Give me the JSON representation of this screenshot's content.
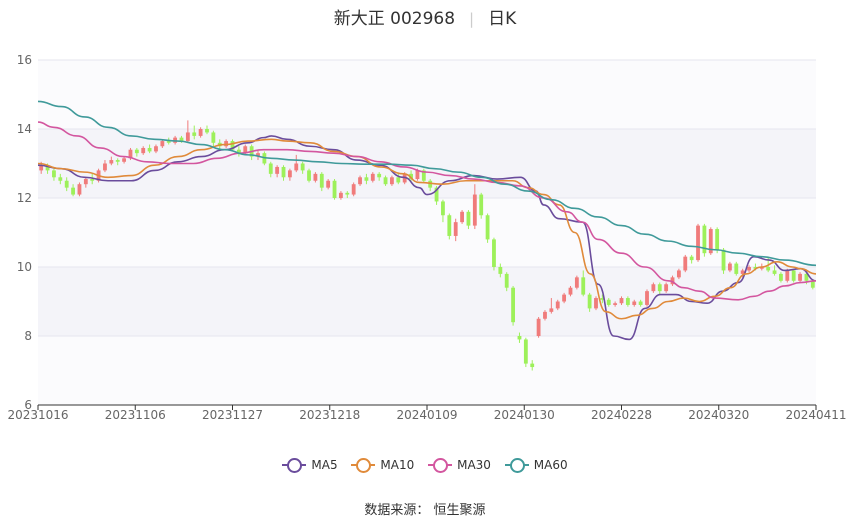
{
  "title": {
    "stock": "新大正 002968",
    "period": "日K"
  },
  "source": "数据来源：  恒生聚源",
  "legend": [
    {
      "label": "MA5",
      "color": "#6a4c9c"
    },
    {
      "label": "MA10",
      "color": "#e08a3a"
    },
    {
      "label": "MA30",
      "color": "#d3569f"
    },
    {
      "label": "MA60",
      "color": "#3f9a9a"
    }
  ],
  "colors": {
    "up": "#f07b7b",
    "down": "#9df05a",
    "band": "#f4f4f9"
  },
  "chart_data": {
    "type": "candlestick",
    "ylim": [
      6,
      16
    ],
    "y_ticks": [
      "6",
      "8",
      "10",
      "12",
      "14",
      "16"
    ],
    "x_tick_labels": [
      "20231016",
      "20231106",
      "20231127",
      "20231218",
      "20240109",
      "20240130",
      "20240228",
      "20240320",
      "20240411"
    ],
    "candles": [
      [
        12.8,
        12.95,
        12.7,
        13.05
      ],
      [
        12.95,
        12.8,
        12.7,
        13.0
      ],
      [
        12.8,
        12.6,
        12.5,
        12.85
      ],
      [
        12.6,
        12.5,
        12.4,
        12.7
      ],
      [
        12.5,
        12.3,
        12.2,
        12.6
      ],
      [
        12.3,
        12.1,
        12.05,
        12.4
      ],
      [
        12.1,
        12.4,
        12.05,
        12.45
      ],
      [
        12.4,
        12.55,
        12.3,
        12.6
      ],
      [
        12.55,
        12.5,
        12.4,
        12.7
      ],
      [
        12.5,
        12.8,
        12.45,
        12.85
      ],
      [
        12.8,
        13.0,
        12.75,
        13.1
      ],
      [
        13.0,
        13.1,
        12.95,
        13.2
      ],
      [
        13.1,
        13.05,
        12.95,
        13.15
      ],
      [
        13.05,
        13.15,
        13.0,
        13.2
      ],
      [
        13.15,
        13.4,
        13.1,
        13.45
      ],
      [
        13.4,
        13.3,
        13.2,
        13.45
      ],
      [
        13.3,
        13.45,
        13.25,
        13.5
      ],
      [
        13.45,
        13.35,
        13.3,
        13.55
      ],
      [
        13.35,
        13.5,
        13.3,
        13.55
      ],
      [
        13.5,
        13.65,
        13.45,
        13.7
      ],
      [
        13.65,
        13.6,
        13.55,
        13.75
      ],
      [
        13.6,
        13.75,
        13.55,
        13.8
      ],
      [
        13.75,
        13.65,
        13.6,
        13.8
      ],
      [
        13.65,
        13.9,
        13.6,
        14.25
      ],
      [
        13.9,
        13.8,
        13.7,
        14.1
      ],
      [
        13.8,
        14.0,
        13.75,
        14.05
      ],
      [
        14.0,
        13.9,
        13.85,
        14.1
      ],
      [
        13.9,
        13.6,
        13.5,
        13.95
      ],
      [
        13.6,
        13.5,
        13.4,
        13.7
      ],
      [
        13.5,
        13.65,
        13.45,
        13.7
      ],
      [
        13.65,
        13.4,
        13.35,
        13.7
      ],
      [
        13.4,
        13.3,
        13.2,
        13.5
      ],
      [
        13.3,
        13.5,
        13.25,
        13.55
      ],
      [
        13.5,
        13.2,
        13.1,
        13.55
      ],
      [
        13.2,
        13.3,
        13.1,
        13.4
      ],
      [
        13.3,
        13.0,
        12.95,
        13.35
      ],
      [
        13.0,
        12.7,
        12.6,
        13.05
      ],
      [
        12.7,
        12.9,
        12.6,
        12.95
      ],
      [
        12.9,
        12.6,
        12.5,
        12.95
      ],
      [
        12.6,
        12.8,
        12.5,
        12.85
      ],
      [
        12.8,
        13.0,
        12.75,
        13.25
      ],
      [
        13.0,
        12.8,
        12.7,
        13.05
      ],
      [
        12.8,
        12.5,
        12.45,
        12.85
      ],
      [
        12.5,
        12.7,
        12.45,
        12.75
      ],
      [
        12.7,
        12.3,
        12.2,
        12.75
      ],
      [
        12.3,
        12.5,
        12.25,
        12.55
      ],
      [
        12.5,
        12.0,
        11.95,
        12.55
      ],
      [
        12.0,
        12.15,
        11.95,
        12.2
      ],
      [
        12.15,
        12.1,
        12.0,
        12.2
      ],
      [
        12.1,
        12.4,
        12.05,
        12.45
      ],
      [
        12.4,
        12.6,
        12.35,
        12.65
      ],
      [
        12.6,
        12.5,
        12.4,
        12.7
      ],
      [
        12.5,
        12.7,
        12.45,
        12.75
      ],
      [
        12.7,
        12.6,
        12.5,
        12.75
      ],
      [
        12.6,
        12.4,
        12.35,
        12.65
      ],
      [
        12.4,
        12.6,
        12.35,
        12.65
      ],
      [
        12.6,
        12.45,
        12.4,
        12.7
      ],
      [
        12.45,
        12.7,
        12.4,
        12.75
      ],
      [
        12.7,
        12.55,
        12.5,
        12.8
      ],
      [
        12.55,
        12.8,
        12.5,
        12.85
      ],
      [
        12.8,
        12.5,
        12.45,
        12.85
      ],
      [
        12.5,
        12.3,
        12.2,
        12.55
      ],
      [
        12.3,
        11.9,
        11.8,
        12.35
      ],
      [
        11.9,
        11.5,
        11.3,
        11.95
      ],
      [
        11.5,
        10.9,
        10.8,
        11.55
      ],
      [
        10.9,
        11.3,
        10.75,
        11.4
      ],
      [
        11.3,
        11.6,
        11.25,
        11.65
      ],
      [
        11.6,
        11.2,
        11.1,
        11.65
      ],
      [
        11.2,
        12.1,
        11.1,
        12.4
      ],
      [
        12.1,
        11.5,
        11.4,
        12.15
      ],
      [
        11.5,
        10.8,
        10.7,
        11.55
      ],
      [
        10.8,
        10.0,
        9.9,
        10.85
      ],
      [
        10.0,
        9.8,
        9.7,
        10.1
      ],
      [
        9.8,
        9.4,
        9.3,
        9.85
      ],
      [
        9.4,
        8.4,
        8.3,
        9.45
      ],
      [
        8.0,
        7.9,
        7.8,
        8.1
      ],
      [
        7.9,
        7.2,
        7.1,
        7.95
      ],
      [
        7.2,
        7.1,
        7.0,
        7.3
      ],
      [
        8.0,
        8.5,
        7.95,
        8.55
      ],
      [
        8.5,
        8.7,
        8.45,
        8.75
      ],
      [
        8.7,
        8.8,
        8.65,
        9.1
      ],
      [
        8.8,
        9.0,
        8.75,
        9.05
      ],
      [
        9.0,
        9.2,
        8.95,
        9.25
      ],
      [
        9.2,
        9.4,
        9.15,
        9.45
      ],
      [
        9.4,
        9.7,
        9.35,
        9.75
      ],
      [
        9.7,
        9.2,
        9.15,
        9.9
      ],
      [
        9.2,
        8.8,
        8.7,
        9.25
      ],
      [
        8.8,
        9.1,
        8.75,
        9.15
      ],
      [
        9.1,
        9.05,
        8.95,
        9.2
      ],
      [
        9.05,
        8.9,
        8.85,
        9.1
      ],
      [
        8.9,
        8.95,
        8.85,
        9.0
      ],
      [
        8.95,
        9.1,
        8.9,
        9.15
      ],
      [
        9.1,
        8.9,
        8.85,
        9.15
      ],
      [
        8.9,
        9.0,
        8.85,
        9.05
      ],
      [
        9.0,
        8.9,
        8.85,
        9.05
      ],
      [
        8.9,
        9.3,
        8.85,
        9.35
      ],
      [
        9.3,
        9.5,
        9.25,
        9.55
      ],
      [
        9.5,
        9.3,
        9.2,
        9.55
      ],
      [
        9.3,
        9.5,
        9.25,
        9.55
      ],
      [
        9.5,
        9.7,
        9.45,
        9.75
      ],
      [
        9.7,
        9.9,
        9.65,
        9.95
      ],
      [
        9.9,
        10.3,
        9.85,
        10.35
      ],
      [
        10.3,
        10.2,
        10.1,
        10.35
      ],
      [
        10.2,
        11.2,
        10.15,
        11.25
      ],
      [
        11.2,
        10.4,
        10.3,
        11.25
      ],
      [
        10.4,
        11.1,
        10.35,
        11.15
      ],
      [
        11.1,
        10.5,
        10.4,
        11.15
      ],
      [
        10.5,
        9.9,
        9.8,
        10.55
      ],
      [
        9.9,
        10.1,
        9.85,
        10.15
      ],
      [
        10.1,
        9.8,
        9.75,
        10.15
      ],
      [
        9.8,
        9.9,
        9.7,
        9.95
      ],
      [
        9.9,
        10.0,
        9.85,
        10.05
      ],
      [
        10.0,
        9.95,
        9.9,
        10.1
      ],
      [
        9.95,
        10.0,
        9.9,
        10.1
      ],
      [
        10.0,
        9.9,
        9.85,
        10.3
      ],
      [
        9.9,
        9.8,
        9.75,
        10.05
      ],
      [
        9.8,
        9.6,
        9.55,
        9.85
      ],
      [
        9.6,
        9.9,
        9.55,
        9.95
      ],
      [
        9.9,
        9.6,
        9.55,
        9.95
      ],
      [
        9.6,
        9.8,
        9.55,
        9.85
      ],
      [
        9.8,
        9.6,
        9.5,
        9.85
      ],
      [
        9.6,
        9.4,
        9.35,
        9.65
      ]
    ],
    "ma": {
      "MA5": [
        [
          0,
          12.95
        ],
        [
          0.03,
          12.85
        ],
        [
          0.06,
          12.6
        ],
        [
          0.09,
          12.5
        ],
        [
          0.12,
          12.5
        ],
        [
          0.15,
          12.8
        ],
        [
          0.18,
          13.05
        ],
        [
          0.21,
          13.2
        ],
        [
          0.24,
          13.4
        ],
        [
          0.27,
          13.6
        ],
        [
          0.29,
          13.75
        ],
        [
          0.3,
          13.8
        ],
        [
          0.32,
          13.7
        ],
        [
          0.35,
          13.5
        ],
        [
          0.38,
          13.4
        ],
        [
          0.41,
          13.1
        ],
        [
          0.44,
          12.95
        ],
        [
          0.47,
          12.6
        ],
        [
          0.49,
          12.3
        ],
        [
          0.5,
          12.1
        ],
        [
          0.53,
          12.5
        ],
        [
          0.56,
          12.65
        ],
        [
          0.59,
          12.55
        ],
        [
          0.62,
          12.6
        ],
        [
          0.64,
          12.2
        ],
        [
          0.65,
          11.8
        ],
        [
          0.67,
          11.4
        ],
        [
          0.7,
          11.3
        ],
        [
          0.72,
          9.5
        ],
        [
          0.74,
          8.0
        ],
        [
          0.76,
          7.9
        ],
        [
          0.78,
          8.8
        ],
        [
          0.8,
          9.2
        ],
        [
          0.82,
          9.2
        ],
        [
          0.84,
          9.0
        ],
        [
          0.86,
          8.95
        ],
        [
          0.88,
          9.3
        ],
        [
          0.9,
          9.55
        ],
        [
          0.92,
          10.3
        ],
        [
          0.94,
          10.2
        ],
        [
          0.96,
          9.9
        ],
        [
          0.98,
          9.95
        ],
        [
          1.0,
          9.6
        ]
      ],
      "MA10": [
        [
          0,
          13.0
        ],
        [
          0.03,
          12.85
        ],
        [
          0.06,
          12.75
        ],
        [
          0.09,
          12.6
        ],
        [
          0.12,
          12.65
        ],
        [
          0.15,
          12.95
        ],
        [
          0.18,
          13.2
        ],
        [
          0.21,
          13.4
        ],
        [
          0.24,
          13.55
        ],
        [
          0.27,
          13.65
        ],
        [
          0.3,
          13.7
        ],
        [
          0.32,
          13.65
        ],
        [
          0.35,
          13.6
        ],
        [
          0.38,
          13.35
        ],
        [
          0.41,
          13.2
        ],
        [
          0.44,
          12.9
        ],
        [
          0.47,
          12.7
        ],
        [
          0.49,
          12.45
        ],
        [
          0.52,
          12.4
        ],
        [
          0.55,
          12.5
        ],
        [
          0.58,
          12.5
        ],
        [
          0.61,
          12.5
        ],
        [
          0.63,
          12.3
        ],
        [
          0.65,
          12.1
        ],
        [
          0.67,
          11.8
        ],
        [
          0.69,
          11.0
        ],
        [
          0.71,
          9.8
        ],
        [
          0.73,
          8.7
        ],
        [
          0.75,
          8.5
        ],
        [
          0.77,
          8.6
        ],
        [
          0.79,
          8.8
        ],
        [
          0.81,
          9.0
        ],
        [
          0.83,
          9.1
        ],
        [
          0.85,
          9.0
        ],
        [
          0.87,
          9.15
        ],
        [
          0.89,
          9.4
        ],
        [
          0.91,
          9.8
        ],
        [
          0.93,
          10.0
        ],
        [
          0.95,
          10.15
        ],
        [
          0.97,
          10.0
        ],
        [
          0.98,
          9.95
        ],
        [
          1.0,
          9.8
        ]
      ],
      "MA30": [
        [
          0,
          14.2
        ],
        [
          0.02,
          14.05
        ],
        [
          0.05,
          13.8
        ],
        [
          0.08,
          13.45
        ],
        [
          0.11,
          13.2
        ],
        [
          0.14,
          13.05
        ],
        [
          0.17,
          13.0
        ],
        [
          0.2,
          13.0
        ],
        [
          0.23,
          13.15
        ],
        [
          0.26,
          13.3
        ],
        [
          0.29,
          13.4
        ],
        [
          0.32,
          13.4
        ],
        [
          0.35,
          13.35
        ],
        [
          0.38,
          13.3
        ],
        [
          0.41,
          13.2
        ],
        [
          0.44,
          13.05
        ],
        [
          0.47,
          12.9
        ],
        [
          0.5,
          12.75
        ],
        [
          0.53,
          12.65
        ],
        [
          0.56,
          12.55
        ],
        [
          0.59,
          12.45
        ],
        [
          0.62,
          12.35
        ],
        [
          0.65,
          12.0
        ],
        [
          0.68,
          11.6
        ],
        [
          0.7,
          11.3
        ],
        [
          0.72,
          10.8
        ],
        [
          0.75,
          10.4
        ],
        [
          0.78,
          10.0
        ],
        [
          0.81,
          9.6
        ],
        [
          0.83,
          9.4
        ],
        [
          0.85,
          9.3
        ],
        [
          0.87,
          9.1
        ],
        [
          0.9,
          9.05
        ],
        [
          0.92,
          9.15
        ],
        [
          0.94,
          9.3
        ],
        [
          0.96,
          9.45
        ],
        [
          0.98,
          9.55
        ],
        [
          1.0,
          9.6
        ]
      ],
      "MA60": [
        [
          0,
          14.8
        ],
        [
          0.03,
          14.65
        ],
        [
          0.06,
          14.35
        ],
        [
          0.09,
          14.05
        ],
        [
          0.12,
          13.8
        ],
        [
          0.15,
          13.7
        ],
        [
          0.18,
          13.65
        ],
        [
          0.21,
          13.55
        ],
        [
          0.24,
          13.4
        ],
        [
          0.27,
          13.25
        ],
        [
          0.3,
          13.15
        ],
        [
          0.33,
          13.1
        ],
        [
          0.36,
          13.05
        ],
        [
          0.39,
          13.0
        ],
        [
          0.42,
          12.98
        ],
        [
          0.45,
          12.98
        ],
        [
          0.48,
          12.95
        ],
        [
          0.51,
          12.85
        ],
        [
          0.54,
          12.75
        ],
        [
          0.57,
          12.6
        ],
        [
          0.6,
          12.4
        ],
        [
          0.63,
          12.2
        ],
        [
          0.66,
          11.95
        ],
        [
          0.69,
          11.7
        ],
        [
          0.72,
          11.45
        ],
        [
          0.75,
          11.2
        ],
        [
          0.78,
          10.95
        ],
        [
          0.81,
          10.75
        ],
        [
          0.84,
          10.6
        ],
        [
          0.87,
          10.5
        ],
        [
          0.9,
          10.4
        ],
        [
          0.93,
          10.3
        ],
        [
          0.96,
          10.2
        ],
        [
          1.0,
          10.05
        ]
      ]
    }
  }
}
